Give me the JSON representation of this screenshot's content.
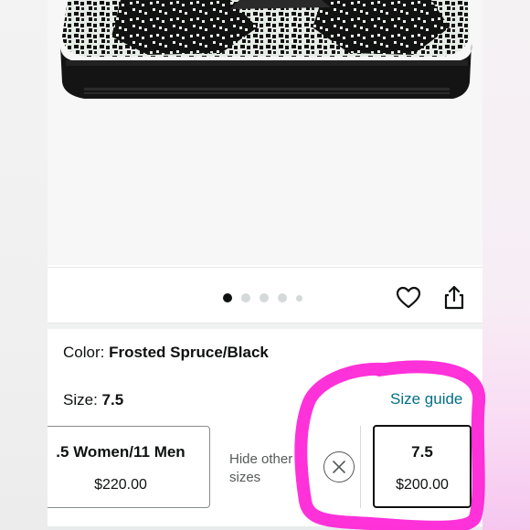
{
  "product": {
    "image_alt": "snakeskin print sneaker"
  },
  "carousel": {
    "dot_count": 5,
    "active_index": 0
  },
  "color": {
    "label": "Color:",
    "value": "Frosted Spruce/Black"
  },
  "size": {
    "label": "Size:",
    "value": "7.5",
    "guide_link": "Size guide"
  },
  "size_options": [
    {
      "title": ".5 Women/11 Men",
      "price": "$220.00",
      "selected": false
    },
    {
      "title": "7.5",
      "price": "$200.00",
      "selected": true
    }
  ],
  "hide_other_sizes": "Hide other sizes",
  "icons": {
    "favorite": "heart-icon",
    "share": "share-icon",
    "close": "close-icon"
  },
  "colors": {
    "link": "#007185",
    "text": "#0f1111",
    "annotation": "#ff1fd6"
  }
}
